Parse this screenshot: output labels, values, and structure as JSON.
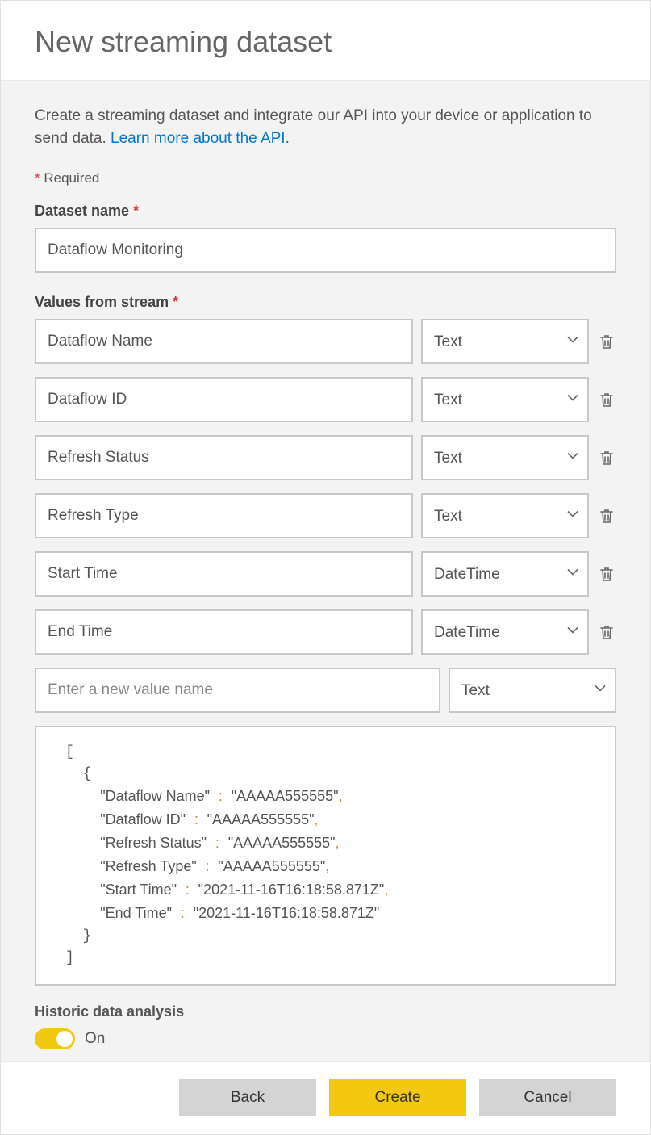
{
  "header": {
    "title": "New streaming dataset"
  },
  "intro": {
    "text1": "Create a streaming dataset and integrate our API into your device or application to send data. ",
    "link": "Learn more about the API",
    "text2": "."
  },
  "requiredNote": "Required",
  "labels": {
    "datasetName": "Dataset name",
    "valuesFromStream": "Values from stream"
  },
  "datasetName": "Dataflow Monitoring",
  "newValuePlaceholder": "Enter a new value name",
  "newValueType": "Text",
  "streamValues": [
    {
      "name": "Dataflow Name",
      "type": "Text"
    },
    {
      "name": "Dataflow ID",
      "type": "Text"
    },
    {
      "name": "Refresh Status",
      "type": "Text"
    },
    {
      "name": "Refresh Type",
      "type": "Text"
    },
    {
      "name": "Start Time",
      "type": "DateTime"
    },
    {
      "name": "End Time",
      "type": "DateTime"
    }
  ],
  "preview": {
    "lines": [
      {
        "key": "Dataflow Name",
        "val": "AAAAA555555",
        "comma": true
      },
      {
        "key": "Dataflow ID",
        "val": "AAAAA555555",
        "comma": true
      },
      {
        "key": "Refresh Status",
        "val": "AAAAA555555",
        "comma": true
      },
      {
        "key": "Refresh Type",
        "val": "AAAAA555555",
        "comma": true
      },
      {
        "key": "Start Time",
        "val": "2021-11-16T16:18:58.871Z",
        "comma": true
      },
      {
        "key": "End Time",
        "val": "2021-11-16T16:18:58.871Z",
        "comma": false
      }
    ]
  },
  "historic": {
    "label": "Historic data analysis",
    "state": "On"
  },
  "footer": {
    "back": "Back",
    "create": "Create",
    "cancel": "Cancel"
  }
}
